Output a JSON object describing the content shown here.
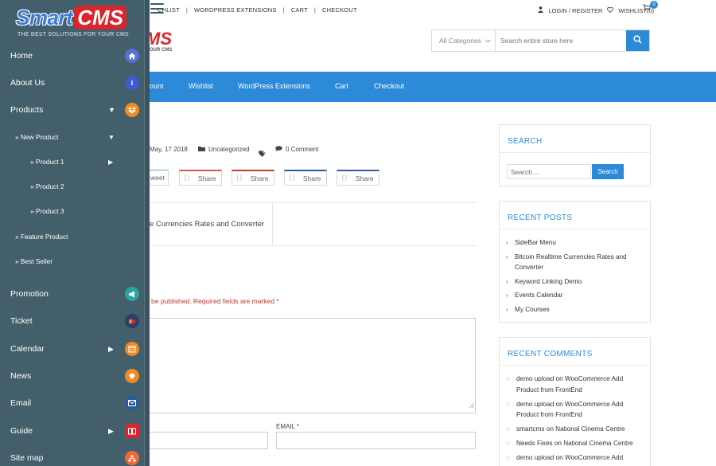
{
  "topbar": {
    "links": [
      "CHLIST",
      "WORDPRESS EXTENSIONS",
      "CART",
      "CHECKOUT"
    ],
    "separator": "|",
    "login": "LOGIN / REGISTER",
    "wishlist": "WISHLIST(0)",
    "cart_count": "0"
  },
  "header": {
    "logo_partial": "MS",
    "logo_partial_tag": "OUR CMS",
    "search_category": "All Categories",
    "search_placeholder": "Search entire store here"
  },
  "nav": {
    "items": [
      "ount",
      "Wishlist",
      "WordPress Extensions",
      "Cart",
      "Checkout"
    ]
  },
  "post": {
    "date": "May, 17 2018",
    "category": "Uncategorized",
    "comments": "0 Comment",
    "share_first": "weet",
    "share_label": "Share",
    "share_brackets": "[ ]",
    "next_post": "e Currencies Rates and Converter",
    "required_note": "be published. Required fields are marked *",
    "email_label": "EMAIL *"
  },
  "widgets": {
    "search": {
      "title": "SEARCH",
      "placeholder": "Search ...",
      "button": "Search"
    },
    "recent_posts": {
      "title": "RECENT POSTS",
      "items": [
        "SideBar Menu",
        "Bitcoin Realtime Currencies Rates and Converter",
        "Keyword Linking Demo",
        "Events Calendar",
        "My Courses"
      ]
    },
    "recent_comments": {
      "title": "RECENT COMMENTS",
      "items": [
        {
          "author": "demo upload",
          "on": "on",
          "post": "WooCommerce Add Product from FrontEnd"
        },
        {
          "author": "demo upload",
          "on": "on",
          "post": "WooCommerce Add Product from FrontEnd"
        },
        {
          "author": "smartcms",
          "on": "on",
          "post": "National Cinema Centre"
        },
        {
          "author": "Needs Fixes",
          "on": "on",
          "post": "National Cinema Centre"
        },
        {
          "author": "demo upload",
          "on": "on",
          "post": "WooCommerce Add Product from FrontEnd"
        }
      ]
    }
  },
  "drawer": {
    "brand_smart": "Smart",
    "brand_cms": "CMS",
    "brand_tag": "THE BEST SOLUTIONS FOR YOUR CMS",
    "items": [
      {
        "label": "Home",
        "icon": "home-icon",
        "color": "#5b6fd6"
      },
      {
        "label": "About Us",
        "icon": "info-icon",
        "color": "#3d5bd1"
      },
      {
        "label": "Products",
        "icon": "dropbox-icon",
        "color": "#f08a24"
      },
      {
        "label": "Promotion",
        "icon": "megaphone-icon",
        "color": "#2aa3a3"
      },
      {
        "label": "Ticket",
        "icon": "ticket-icon",
        "color": "#2c3e6e"
      },
      {
        "label": "Calendar",
        "icon": "calendar-icon",
        "color": "#f08a24"
      },
      {
        "label": "News",
        "icon": "news-icon",
        "color": "#f08a24"
      },
      {
        "label": "Email",
        "icon": "email-icon",
        "color": "#2c5a9e"
      },
      {
        "label": "Guide",
        "icon": "book-icon",
        "color": "#d9262c"
      },
      {
        "label": "Site map",
        "icon": "sitemap-icon",
        "color": "#f0673a"
      }
    ],
    "subitems": [
      {
        "label": "» New Product"
      },
      {
        "label": "» Product 1"
      },
      {
        "label": "» Product 2"
      },
      {
        "label": "» Product 3"
      },
      {
        "label": "» Feature Product"
      },
      {
        "label": "» Best Seller"
      }
    ]
  },
  "colors": {
    "accent": "#2d8ad8",
    "drawer_bg": "#425f6b",
    "brand_red": "#d9262c",
    "required_red": "#c0392b"
  }
}
